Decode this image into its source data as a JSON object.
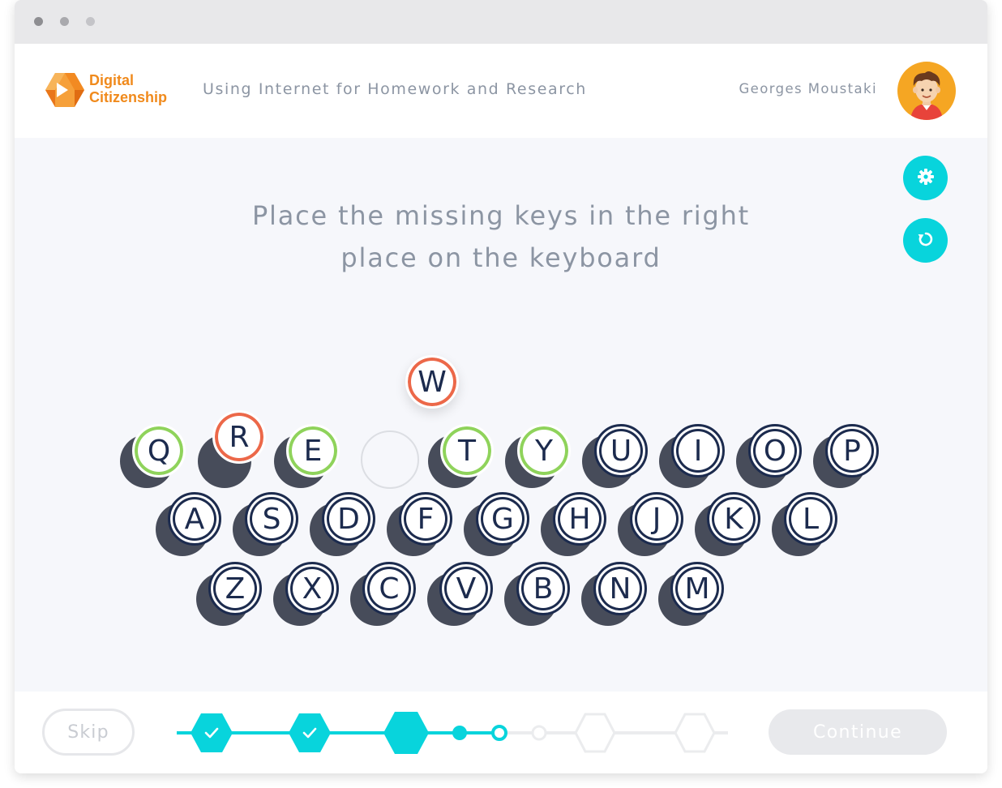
{
  "window": {
    "controls": [
      "close",
      "minimize",
      "zoom"
    ]
  },
  "header": {
    "logo": {
      "line1": "Digital",
      "line2": "Citizenship",
      "icon": "logo-hexagon-icon"
    },
    "course_title": "Using Internet for Homework and Research",
    "user_name": "Georges Moustaki",
    "avatar_icon": "user-avatar-icon"
  },
  "side_buttons": {
    "settings_icon": "gear-icon",
    "restart_icon": "refresh-icon"
  },
  "instruction": {
    "line1": "Place the missing keys in the right",
    "line2": "place on the keyboard"
  },
  "keyboard": {
    "row1": [
      "Q",
      "R",
      "E",
      "",
      "T",
      "Y",
      "U",
      "I",
      "O",
      "P"
    ],
    "row2": [
      "A",
      "S",
      "D",
      "F",
      "G",
      "H",
      "J",
      "K",
      "L"
    ],
    "row3": [
      "Z",
      "X",
      "C",
      "V",
      "B",
      "N",
      "M"
    ],
    "correct_keys": [
      "Q",
      "E",
      "T",
      "Y"
    ],
    "wrong_keys": [
      "R"
    ],
    "floating_key": "W",
    "empty_slot_index_row1": 3
  },
  "footer": {
    "skip_label": "Skip",
    "continue_label": "Continue",
    "progress_steps": [
      {
        "kind": "hexagon",
        "state": "done",
        "icon": "check-icon"
      },
      {
        "kind": "hexagon",
        "state": "done",
        "icon": "check-icon"
      },
      {
        "kind": "hexagon",
        "state": "current"
      },
      {
        "kind": "dot",
        "state": "done"
      },
      {
        "kind": "dot",
        "state": "current"
      },
      {
        "kind": "dot",
        "state": "todo"
      },
      {
        "kind": "hexagon",
        "state": "todo"
      },
      {
        "kind": "hexagon",
        "state": "todo"
      }
    ]
  },
  "colors": {
    "accent": "#08d4dc",
    "brand": "#f08a1c",
    "key_text": "#1c2b4e",
    "key_shadow": "#474c5a",
    "correct": "#8fd35b",
    "wrong": "#ec6849",
    "muted_text": "#8c95a3"
  }
}
